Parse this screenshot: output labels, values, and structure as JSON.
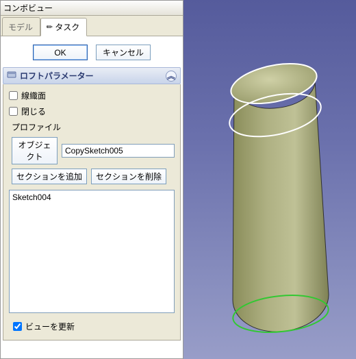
{
  "pane_title": "コンボビュー",
  "tabs": {
    "model": "モデル",
    "task": "タスク"
  },
  "buttons": {
    "ok": "OK",
    "cancel": "キャンセル"
  },
  "group": {
    "title": "ロフトパラメーター"
  },
  "checks": {
    "ruled": "線織面",
    "closed": "閉じる"
  },
  "profile": {
    "label": "プロファイル",
    "object_btn": "オブジェクト",
    "value": "CopySketch005"
  },
  "sections": {
    "add": "セクションを追加",
    "remove": "セクションを削除"
  },
  "list": {
    "items": [
      "Sketch004"
    ]
  },
  "update_view": "ビューを更新",
  "glyphs": {
    "pencil": "✎",
    "caret_up": "︽"
  }
}
